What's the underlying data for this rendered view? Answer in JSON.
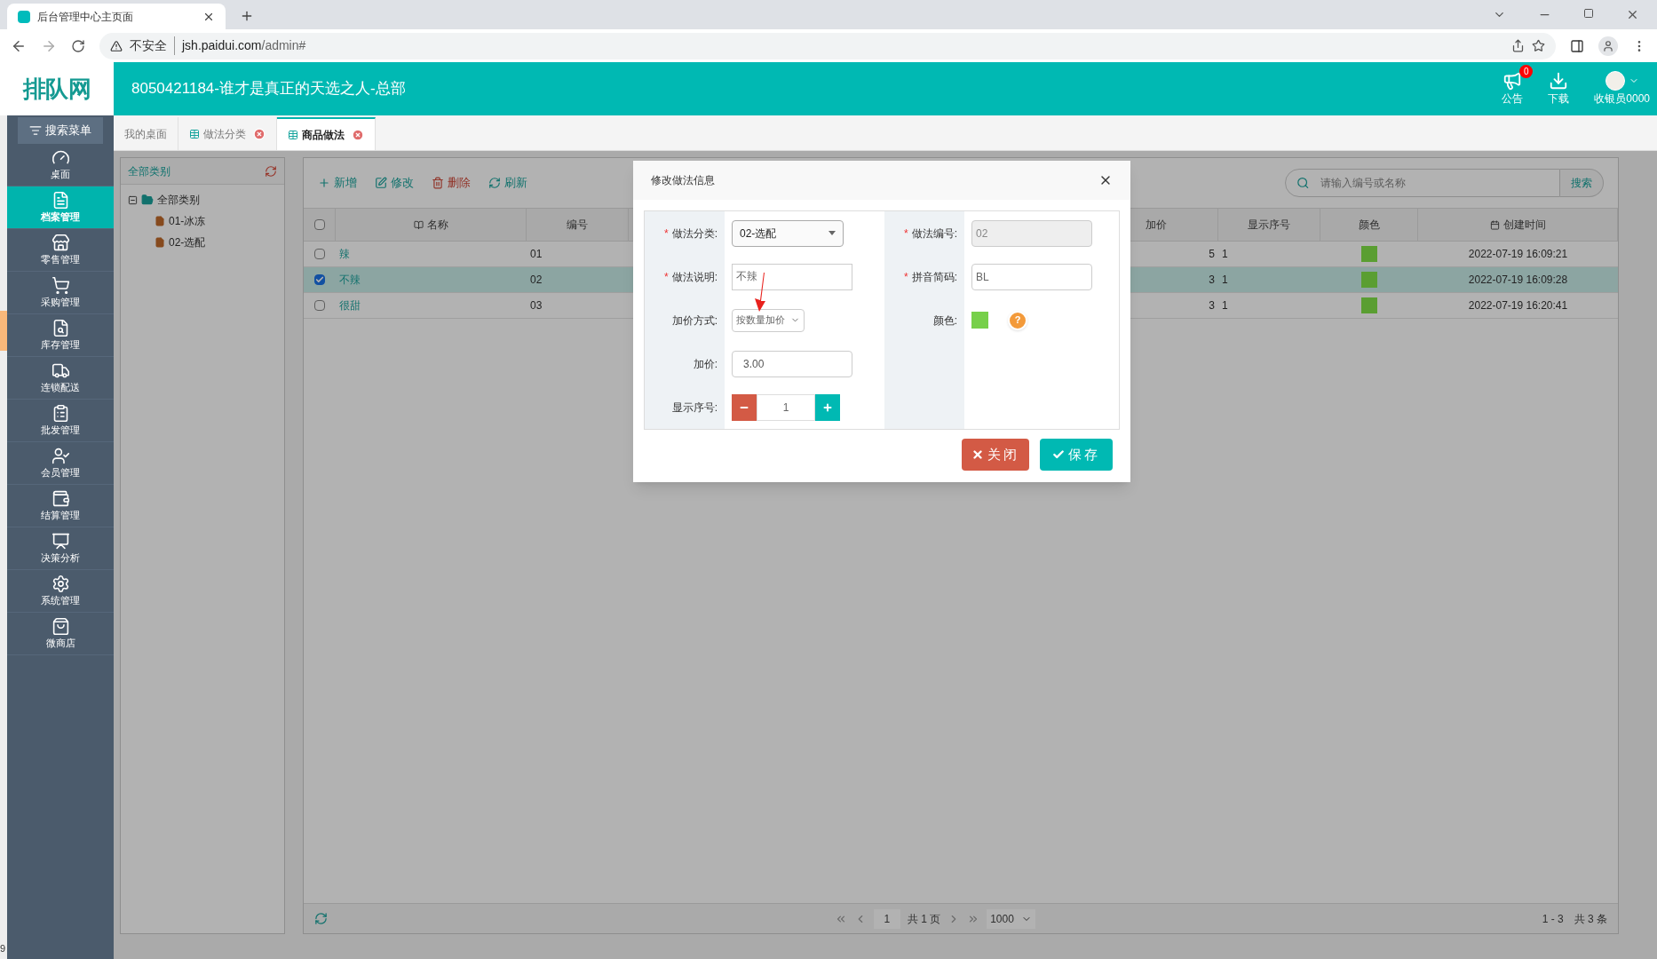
{
  "browser": {
    "tab_title": "后台管理中心主页面",
    "security": "不安全",
    "url_host": "jsh.paidui.com",
    "url_path": "/admin#"
  },
  "header": {
    "logo": "排队网",
    "title": "8050421184-谁才是真正的天选之人-总部",
    "notice_label": "公告",
    "notice_count": "0",
    "download_label": "下载",
    "user": "收银员0000"
  },
  "sidebar": {
    "search": "搜索菜单",
    "items": [
      {
        "label": "桌面",
        "selected": false
      },
      {
        "label": "档案管理",
        "selected": true
      },
      {
        "label": "零售管理",
        "selected": false
      },
      {
        "label": "采购管理",
        "selected": false
      },
      {
        "label": "库存管理",
        "selected": false
      },
      {
        "label": "连锁配送",
        "selected": false
      },
      {
        "label": "批发管理",
        "selected": false
      },
      {
        "label": "会员管理",
        "selected": false
      },
      {
        "label": "结算管理",
        "selected": false
      },
      {
        "label": "决策分析",
        "selected": false
      },
      {
        "label": "系统管理",
        "selected": false
      },
      {
        "label": "微商店",
        "selected": false
      }
    ]
  },
  "left_edge_text": "9",
  "tabs": [
    {
      "label": "我的桌面",
      "selected": false,
      "closable": false
    },
    {
      "label": "做法分类",
      "selected": false,
      "closable": true
    },
    {
      "label": "商品做法",
      "selected": true,
      "closable": true
    }
  ],
  "tree": {
    "title": "全部类别",
    "root": {
      "label": "全部类别",
      "expanded": true,
      "children": [
        {
          "label": "01-冰冻"
        },
        {
          "label": "02-选配"
        }
      ]
    }
  },
  "toolbar": [
    "新增",
    "修改",
    "删除",
    "刷新"
  ],
  "search": {
    "placeholder": "请输入编号或名称",
    "button": "搜索"
  },
  "table": {
    "columns": [
      "名称",
      "编号",
      "加价",
      "显示序号",
      "颜色",
      "创建时间"
    ],
    "select_all_checked": false,
    "rows": [
      {
        "name": "辣",
        "code": "01",
        "price": "5",
        "order": "1",
        "color": "#5a9e32",
        "created": "2022-07-19 16:09:21",
        "selected": false
      },
      {
        "name": "不辣",
        "code": "02",
        "price": "3",
        "order": "1",
        "color": "#5a9e32",
        "created": "2022-07-19 16:09:28",
        "selected": true
      },
      {
        "name": "很甜",
        "code": "03",
        "price": "3",
        "order": "1",
        "color": "#5a9e32",
        "created": "2022-07-19 16:20:41",
        "selected": false
      }
    ]
  },
  "pager": {
    "page": "1",
    "pages": "共 1 页",
    "size": "1000",
    "range": "1 - 3",
    "total": "共 3 条"
  },
  "dialog": {
    "title": "修改做法信息",
    "category": {
      "label": "做法分类:",
      "required_mark": "*",
      "value": "02-选配"
    },
    "code": {
      "label": "做法编号:",
      "required_mark": "*",
      "value": "02"
    },
    "desc": {
      "label": "做法说明:",
      "required_mark": "*",
      "value": "不辣"
    },
    "pinyin": {
      "label": "拼音简码:",
      "required_mark": "*",
      "value": "BL"
    },
    "method": {
      "label": "加价方式:",
      "value": "按数量加价"
    },
    "color": {
      "label": "颜色:",
      "color": "#77d04a",
      "help": "?"
    },
    "price": {
      "label": "加价:",
      "value": "3.00"
    },
    "order": {
      "label": "显示序号:",
      "value": "1"
    },
    "close": "关闭",
    "save": "保存"
  }
}
